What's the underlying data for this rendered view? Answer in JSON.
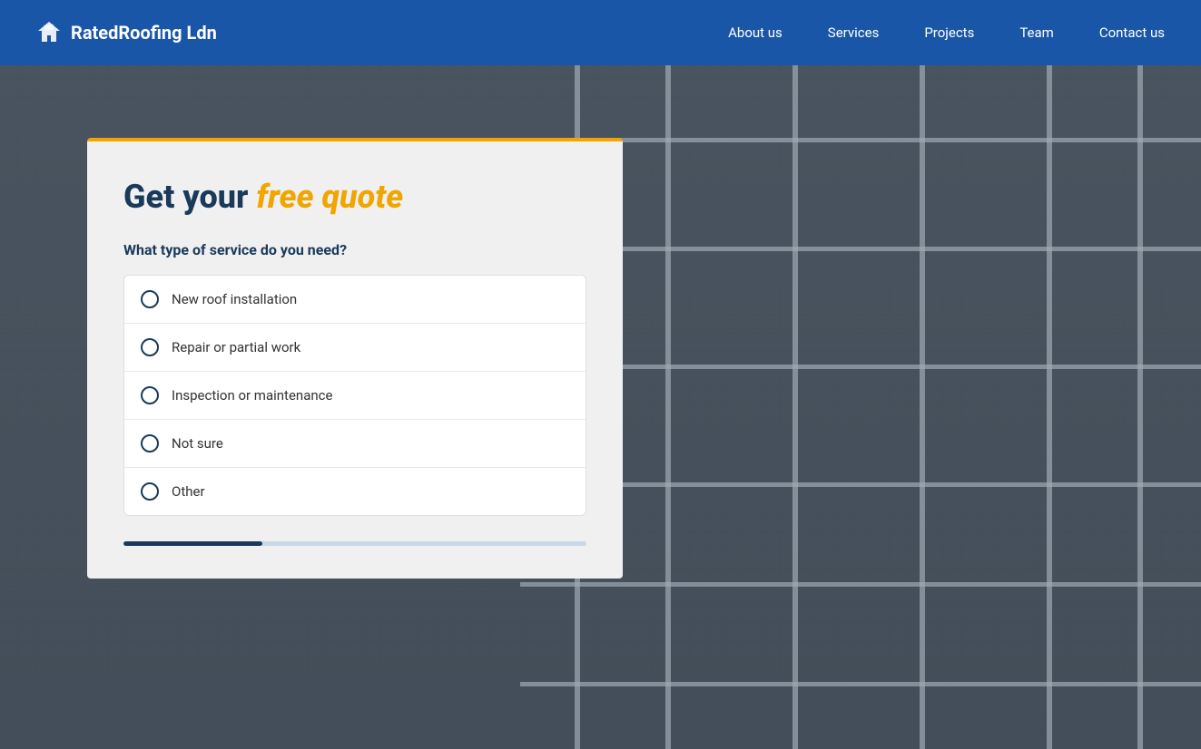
{
  "navbar": {
    "logo_text": "RatedRoofing Ldn",
    "links": [
      {
        "label": "About us",
        "id": "about-us"
      },
      {
        "label": "Services",
        "id": "services"
      },
      {
        "label": "Projects",
        "id": "projects"
      },
      {
        "label": "Team",
        "id": "team"
      },
      {
        "label": "Contact us",
        "id": "contact-us"
      }
    ]
  },
  "quote_form": {
    "title_plain": "Get your ",
    "title_highlight": "free quote",
    "question": "What type of service do you need?",
    "options": [
      {
        "id": "new-roof",
        "label": "New roof installation"
      },
      {
        "id": "repair",
        "label": "Repair or partial work"
      },
      {
        "id": "inspection",
        "label": "Inspection or maintenance"
      },
      {
        "id": "not-sure",
        "label": "Not sure"
      },
      {
        "id": "other",
        "label": "Other"
      }
    ],
    "progress_percent": 30
  }
}
